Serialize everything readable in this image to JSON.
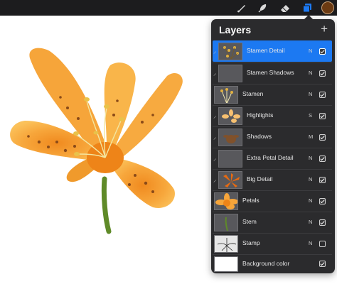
{
  "toolbar": {
    "tools": [
      {
        "name": "brush-icon"
      },
      {
        "name": "smudge-icon"
      },
      {
        "name": "eraser-icon"
      },
      {
        "name": "layers-icon",
        "active": true,
        "color": "#1c79f2"
      }
    ],
    "color_swatch": "#6b3a12"
  },
  "layers_panel": {
    "title": "Layers",
    "add_label": "+",
    "layers": [
      {
        "name": "Stamen Detail",
        "blend": "N",
        "visible": true,
        "selected": true,
        "clipped": true
      },
      {
        "name": "Stamen Shadows",
        "blend": "N",
        "visible": true,
        "clipped": true
      },
      {
        "name": "Stamen",
        "blend": "N",
        "visible": true,
        "clipped": false
      },
      {
        "name": "Highlights",
        "blend": "S",
        "visible": true,
        "clipped": true
      },
      {
        "name": "Shadows",
        "blend": "M",
        "visible": true,
        "clipped": true
      },
      {
        "name": "Extra Petal Detail",
        "blend": "N",
        "visible": true,
        "clipped": true
      },
      {
        "name": "Big Detail",
        "blend": "N",
        "visible": true,
        "clipped": true
      },
      {
        "name": "Petals",
        "blend": "N",
        "visible": true,
        "clipped": false
      },
      {
        "name": "Stem",
        "blend": "N",
        "visible": true,
        "clipped": false
      },
      {
        "name": "Stamp",
        "blend": "N",
        "visible": false,
        "clipped": false
      },
      {
        "name": "Background color",
        "blend": "",
        "visible": true,
        "clipped": false
      }
    ]
  },
  "colors": {
    "accent": "#1c79f2",
    "panel": "#2b2b2d",
    "petal": "#f6a53a"
  }
}
